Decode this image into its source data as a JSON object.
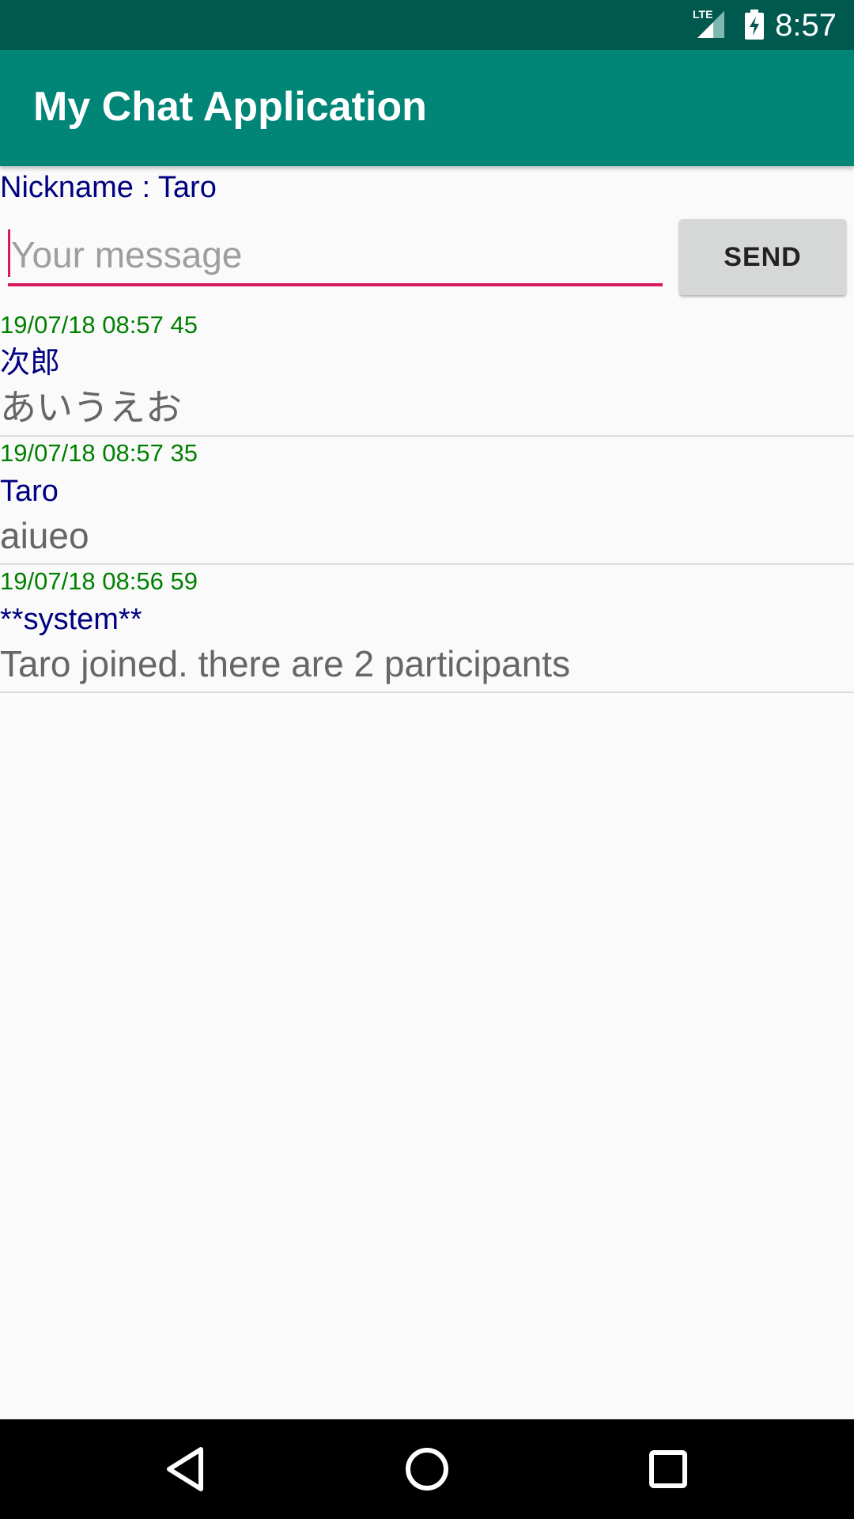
{
  "status_bar": {
    "network": "LTE",
    "time": "8:57",
    "icons": [
      "lte-icon",
      "signal-icon",
      "battery-charging-icon"
    ]
  },
  "app_bar": {
    "title": "My Chat Application"
  },
  "nickname": {
    "text": "Nickname : Taro"
  },
  "composer": {
    "placeholder": "Your message",
    "value": "",
    "send_label": "SEND"
  },
  "messages": [
    {
      "time": "19/07/18 08:57 45",
      "author": "次郎",
      "text": "あいうえお"
    },
    {
      "time": "19/07/18 08:57 35",
      "author": "Taro",
      "text": "aiueo"
    },
    {
      "time": "19/07/18 08:56 59",
      "author": "**system**",
      "text": "Taro joined. there are 2 participants"
    }
  ],
  "nav_bar": {
    "icons": [
      "back-icon",
      "home-icon",
      "recents-icon"
    ]
  },
  "colors": {
    "status_bar": "#00594e",
    "app_bar": "#008577",
    "accent": "#d81b60",
    "nickname": "#000080",
    "timestamp": "#008000",
    "message_text": "#666666"
  }
}
